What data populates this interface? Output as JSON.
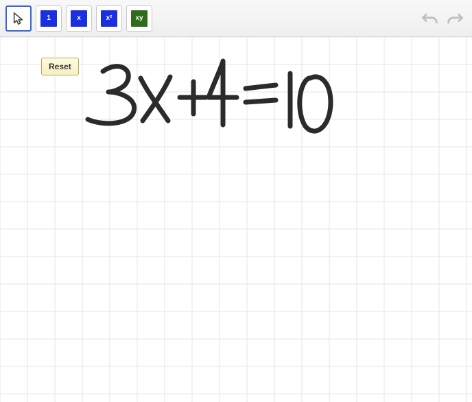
{
  "toolbar": {
    "tools": [
      {
        "name": "pointer-tool",
        "selected": true,
        "tile_color": null,
        "label": "",
        "icon": "pointer"
      },
      {
        "name": "constant-tile",
        "selected": false,
        "tile_color": "blue",
        "label": "1",
        "icon": null
      },
      {
        "name": "x-tile",
        "selected": false,
        "tile_color": "blue",
        "label": "x",
        "icon": null
      },
      {
        "name": "x-squared-tile",
        "selected": false,
        "tile_color": "blue",
        "label": "x²",
        "icon": null
      },
      {
        "name": "xy-tile",
        "selected": false,
        "tile_color": "green",
        "label": "xy",
        "icon": null
      }
    ],
    "undo_label": "Undo",
    "redo_label": "Redo"
  },
  "canvas": {
    "grid_spacing": 40,
    "reset_label": "Reset",
    "handwritten_equation": "3x+4=10"
  }
}
